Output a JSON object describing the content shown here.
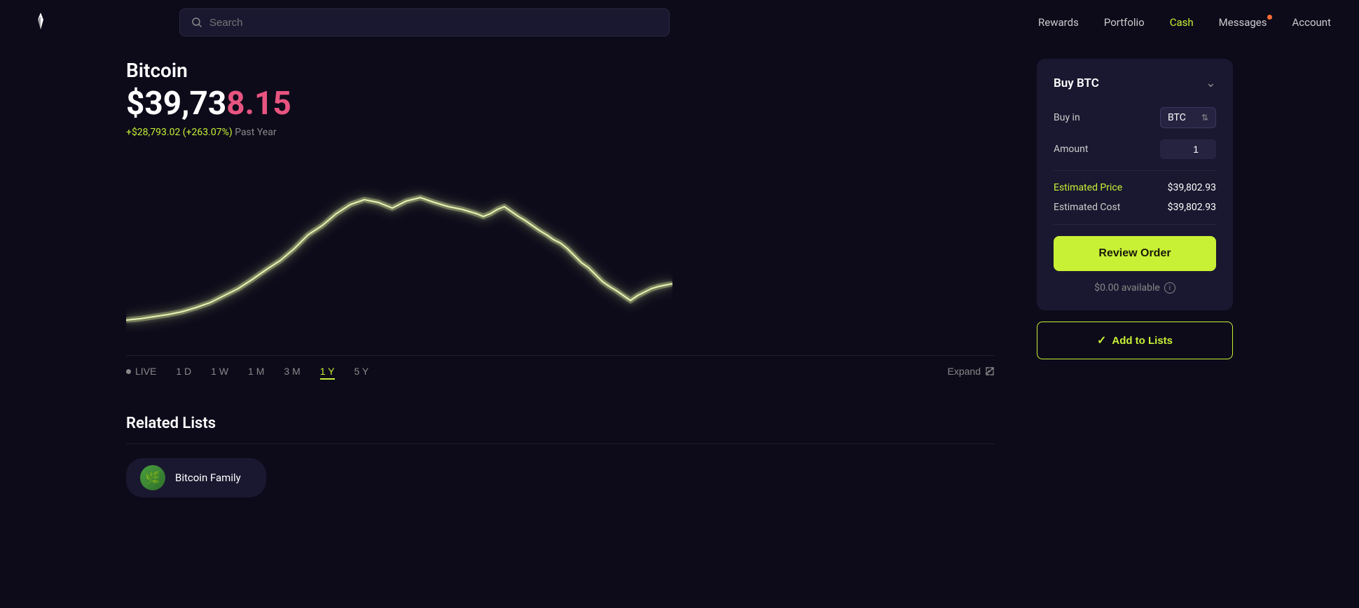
{
  "header": {
    "search_placeholder": "Search",
    "nav": {
      "rewards": "Rewards",
      "portfolio": "Portfolio",
      "cash": "Cash",
      "messages": "Messages",
      "account": "Account"
    }
  },
  "coin": {
    "name": "Bitcoin",
    "price_whole": "$39,73",
    "price_decimal": "8.15",
    "change_positive": "+$28,793.02 (+263.07%)",
    "change_label": " Past Year"
  },
  "timerange": {
    "live": "LIVE",
    "1d": "1 D",
    "1w": "1 W",
    "1m": "1 M",
    "3m": "3 M",
    "1y": "1 Y",
    "5y": "5 Y",
    "expand": "Expand"
  },
  "related": {
    "title": "Related Lists",
    "items": [
      {
        "name": "Bitcoin Family",
        "emoji": "🌿"
      }
    ]
  },
  "buy_panel": {
    "title": "Buy BTC",
    "buy_in_label": "Buy in",
    "buy_in_value": "BTC",
    "amount_label": "Amount",
    "amount_value": "1",
    "estimated_price_label": "Estimated Price",
    "estimated_price_value": "$39,802.93",
    "estimated_cost_label": "Estimated Cost",
    "estimated_cost_value": "$39,802.93",
    "review_btn": "Review Order",
    "available": "$0.00 available",
    "add_to_lists": "Add to Lists"
  }
}
